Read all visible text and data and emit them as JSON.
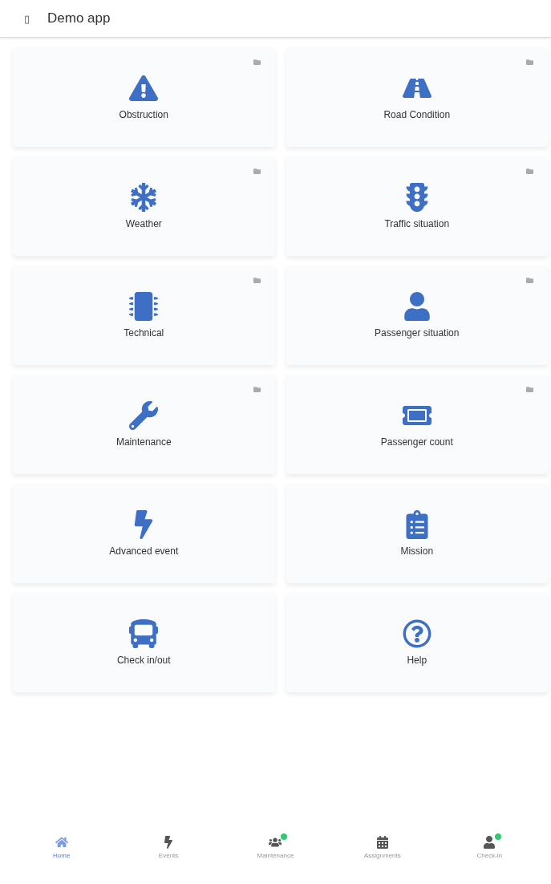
{
  "app_bar": {
    "menu_glyph": "▯",
    "title": "Demo app"
  },
  "tiles": [
    {
      "label": "Obstruction",
      "kind": "warning",
      "folder": true
    },
    {
      "label": "Road Condition",
      "kind": "road",
      "folder": true
    },
    {
      "label": "Weather",
      "kind": "snow",
      "folder": true
    },
    {
      "label": "Traffic situation",
      "kind": "traffic",
      "folder": true
    },
    {
      "label": "Technical",
      "kind": "chip",
      "folder": true
    },
    {
      "label": "Passenger situation",
      "kind": "person",
      "folder": true
    },
    {
      "label": "Maintenance",
      "kind": "wrench",
      "folder": true
    },
    {
      "label": "Passenger count",
      "kind": "ticket",
      "folder": true
    },
    {
      "label": "Advanced event",
      "kind": "bolt",
      "folder": false
    },
    {
      "label": "Mission",
      "kind": "clipboard",
      "folder": false
    },
    {
      "label": "Check in/out",
      "kind": "bus",
      "folder": false
    },
    {
      "label": "Help",
      "kind": "help",
      "folder": false
    }
  ],
  "tab_bar": [
    {
      "label": "Home",
      "kind": "home",
      "selected": true
    },
    {
      "label": "Events",
      "kind": "bolt",
      "selected": false
    },
    {
      "label": "Maintenance",
      "kind": "people",
      "selected": false,
      "color": "#2ecc71"
    },
    {
      "label": "Assignments",
      "kind": "calendar",
      "selected": false
    },
    {
      "label": "Check-in",
      "kind": "person",
      "selected": false,
      "color": "#2ecc71"
    }
  ]
}
